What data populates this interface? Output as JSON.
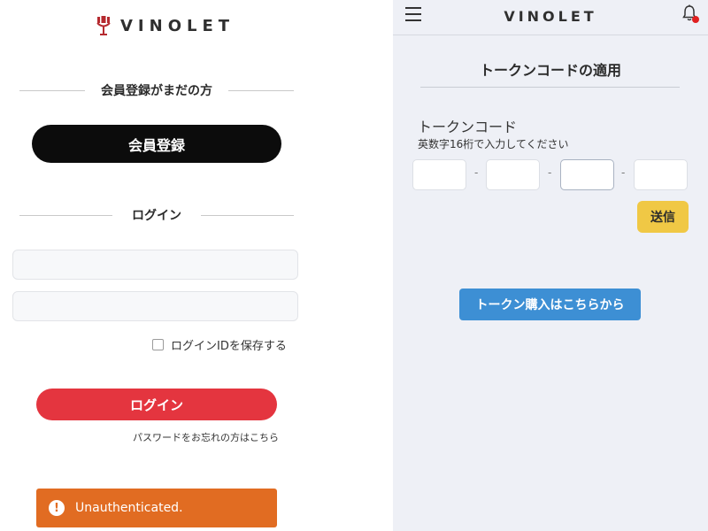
{
  "login_page": {
    "brand": {
      "name": "VINOLET",
      "icon": "wine-glass-logo-icon"
    },
    "register_section": {
      "heading": "会員登録がまだの方",
      "button_label": "会員登録"
    },
    "login_section": {
      "heading": "ログイン",
      "id_input": {
        "value": "",
        "placeholder": ""
      },
      "password_input": {
        "value": "",
        "placeholder": ""
      },
      "remember_label": "ログインIDを保存する",
      "remember_checked": false,
      "login_button": "ログイン",
      "forgot_link": "パスワードをお忘れの方はこちら"
    },
    "toast": {
      "icon": "exclamation-icon",
      "message": "Unauthenticated.",
      "color": "#e16c22"
    }
  },
  "token_page": {
    "header": {
      "title": "VINOLET",
      "menu_icon": "hamburger-menu-icon",
      "notification_icon": "bell-icon"
    },
    "title": "トークンコードの適用",
    "token_label": "トークンコード",
    "token_hint": "英数字16桁で入力してください",
    "token_fields": [
      "",
      "",
      "",
      ""
    ],
    "separator": "-",
    "submit_button": "送信",
    "buy_button": "トークン購入はこちらから"
  },
  "colors": {
    "register_button": "#0c0c0c",
    "login_button": "#e4353f",
    "submit_button": "#f0c845",
    "buy_button": "#3d8fd4",
    "right_background": "#eef0f6"
  }
}
